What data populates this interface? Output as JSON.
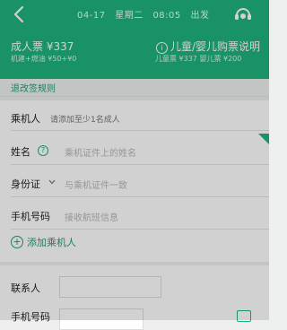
{
  "header": {
    "date": "04-17",
    "weekday": "星期二",
    "time": "08:05",
    "departure": "出发",
    "fare_label": "成人票 ¥337",
    "fare_detail": "机建+燃油 ¥50+¥0",
    "child_link": "儿童/婴儿购票说明",
    "child_fare_detail": "儿童票 ¥337 婴儿票 ¥200"
  },
  "rules_link": "退改签规则",
  "passenger": {
    "title": "乘机人",
    "title_hint": "请添加至少1名成人",
    "name_label": "姓名",
    "name_placeholder": "乘机证件上的姓名",
    "id_label": "身份证",
    "id_placeholder": "与乘机证件一致",
    "phone_label": "手机号码",
    "phone_placeholder": "接收航班信息",
    "add_button": "添加乘机人"
  },
  "contact": {
    "name_label": "联系人",
    "phone_label": "手机号码"
  },
  "colors": {
    "brand": "#1fb27c",
    "link": "#1fa070"
  },
  "icons": [
    "back-icon",
    "service-icon",
    "help-icon",
    "chevron-down-icon",
    "add-icon",
    "contact-book-icon"
  ]
}
